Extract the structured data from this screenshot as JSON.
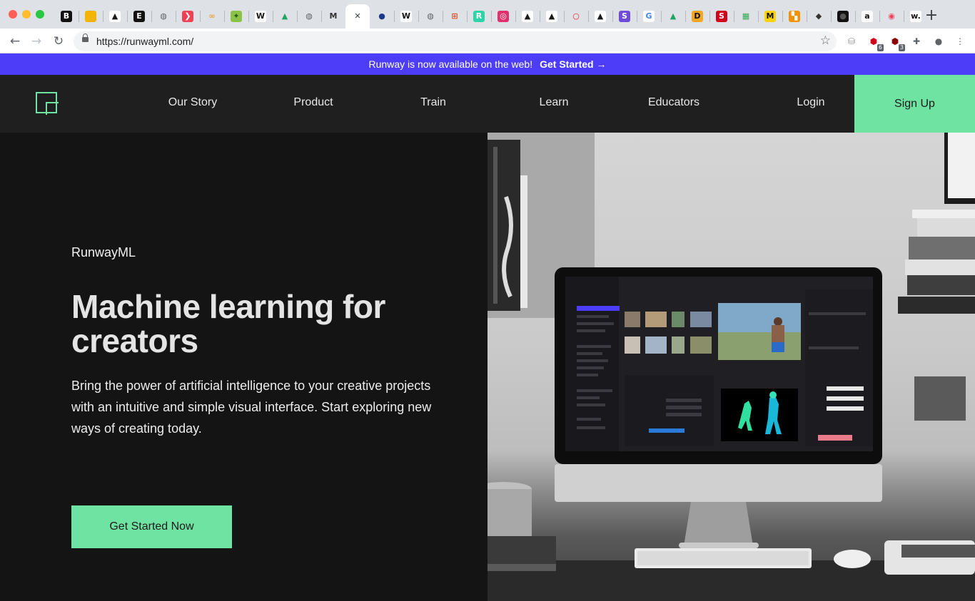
{
  "browser": {
    "tabs": [
      {
        "icon": "bold-b-icon",
        "glyph": "B",
        "bg": "#111111",
        "fg": "#ffffff"
      },
      {
        "icon": "slides-icon",
        "glyph": "",
        "bg": "#f4b400",
        "fg": "#ffffff"
      },
      {
        "icon": "runway-app-icon",
        "glyph": "▲",
        "bg": "#ffffff",
        "fg": "#1a1a1a"
      },
      {
        "icon": "e-icon",
        "glyph": "E",
        "bg": "#111111",
        "fg": "#ffffff"
      },
      {
        "icon": "globe-icon",
        "glyph": "◍",
        "bg": "#dee1e6",
        "fg": "#5f6368"
      },
      {
        "icon": "pocket-icon",
        "glyph": "❯",
        "bg": "#ef4056",
        "fg": "#ffffff"
      },
      {
        "icon": "infinity-icon",
        "glyph": "∞",
        "bg": "#dee1e6",
        "fg": "#e8a33c"
      },
      {
        "icon": "leaf-icon",
        "glyph": "✦",
        "bg": "#8bc34a",
        "fg": "#2e5d10"
      },
      {
        "icon": "wikipedia-icon",
        "glyph": "W",
        "bg": "#ffffff",
        "fg": "#111111"
      },
      {
        "icon": "google-drive-icon",
        "glyph": "▲",
        "bg": "#dee1e6",
        "fg": "#1fa463"
      },
      {
        "icon": "globe-icon",
        "glyph": "◍",
        "bg": "#dee1e6",
        "fg": "#5f6368"
      },
      {
        "icon": "medium-icon",
        "glyph": "M",
        "bg": "#dee1e6",
        "fg": "#333333"
      },
      {
        "icon": "close-tab-icon",
        "glyph": "✕",
        "bg": "#ffffff",
        "fg": "#3c4043"
      },
      {
        "icon": "blue-sphere-icon",
        "glyph": "●",
        "bg": "#dee1e6",
        "fg": "#1a3a8a"
      },
      {
        "icon": "wikipedia-icon",
        "glyph": "W",
        "bg": "#ffffff",
        "fg": "#111111"
      },
      {
        "icon": "globe-icon",
        "glyph": "◍",
        "bg": "#dee1e6",
        "fg": "#5f6368"
      },
      {
        "icon": "frame-icon",
        "glyph": "⊞",
        "bg": "#dee1e6",
        "fg": "#d9502b"
      },
      {
        "icon": "r-icon",
        "glyph": "R",
        "bg": "#2dd4a8",
        "fg": "#ffffff"
      },
      {
        "icon": "instagram-icon",
        "glyph": "◎",
        "bg": "#e1306c",
        "fg": "#ffffff"
      },
      {
        "icon": "runway-app-icon",
        "glyph": "▲",
        "bg": "#ffffff",
        "fg": "#1a1a1a"
      },
      {
        "icon": "runway-app-icon",
        "glyph": "▲",
        "bg": "#ffffff",
        "fg": "#1a1a1a"
      },
      {
        "icon": "opera-icon",
        "glyph": "○",
        "bg": "#dee1e6",
        "fg": "#e2231a"
      },
      {
        "icon": "runway-app-icon",
        "glyph": "▲",
        "bg": "#ffffff",
        "fg": "#1a1a1a"
      },
      {
        "icon": "s-circle-icon",
        "glyph": "S",
        "bg": "#6e4bd8",
        "fg": "#ffffff"
      },
      {
        "icon": "google-icon",
        "glyph": "G",
        "bg": "#ffffff",
        "fg": "#4285f4"
      },
      {
        "icon": "google-drive-icon",
        "glyph": "▲",
        "bg": "#dee1e6",
        "fg": "#1fa463"
      },
      {
        "icon": "d-icon",
        "glyph": "D",
        "bg": "#f5a623",
        "fg": "#111111"
      },
      {
        "icon": "s-red-icon",
        "glyph": "S",
        "bg": "#d0021b",
        "fg": "#ffffff"
      },
      {
        "icon": "sheets-icon",
        "glyph": "▦",
        "bg": "#dee1e6",
        "fg": "#34a853"
      },
      {
        "icon": "m-yellow-icon",
        "glyph": "M",
        "bg": "#ffd400",
        "fg": "#111111"
      },
      {
        "icon": "orange-grid-icon",
        "glyph": "▚",
        "bg": "#f29200",
        "fg": "#ffffff"
      },
      {
        "icon": "diamond-icon",
        "glyph": "◆",
        "bg": "#dee1e6",
        "fg": "#333333"
      },
      {
        "icon": "black-circle-icon",
        "glyph": "●",
        "bg": "#111111",
        "fg": "#555555"
      },
      {
        "icon": "amazon-icon",
        "glyph": "a",
        "bg": "#ffffff",
        "fg": "#111111"
      },
      {
        "icon": "target-icon",
        "glyph": "◉",
        "bg": "#dee1e6",
        "fg": "#ef4056"
      },
      {
        "icon": "w-dot-icon",
        "glyph": "w.",
        "bg": "#ffffff",
        "fg": "#111111"
      }
    ],
    "address_bar": {
      "url": "https://runwayml.com/"
    },
    "extensions": [
      {
        "icon": "db-extension-icon",
        "badge": ""
      },
      {
        "icon": "adblock-icon",
        "badge": "6"
      },
      {
        "icon": "ublock-icon",
        "badge": "3"
      },
      {
        "icon": "puzzle-icon",
        "badge": ""
      },
      {
        "icon": "profile-icon",
        "badge": ""
      },
      {
        "icon": "menu-dots-icon",
        "badge": ""
      }
    ]
  },
  "banner": {
    "text": "Runway is now available on the web!",
    "link": "Get Started →"
  },
  "nav": {
    "items": [
      "Our Story",
      "Product",
      "Train",
      "Learn",
      "Educators"
    ],
    "login": "Login",
    "signup": "Sign Up"
  },
  "hero": {
    "brand": "RunwayML",
    "headline": "Machine learning for creators",
    "subheadline": "Bring the power of artificial intelligence to your creative projects with an intuitive and simple visual interface. Start exploring new ways of creating today.",
    "cta": "Get Started Now"
  },
  "theme": {
    "accent": "#6fe3a2",
    "banner": "#4d3cf8",
    "background": "#141414",
    "nav_background": "#1f1f1f"
  }
}
